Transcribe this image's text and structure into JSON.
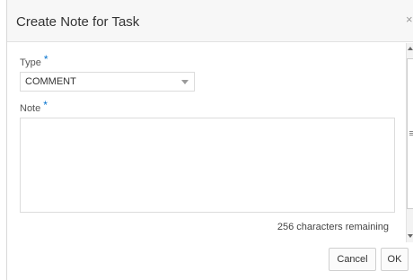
{
  "dialog": {
    "title": "Create Note for Task",
    "close_icon": "close-icon",
    "close_glyph": "×"
  },
  "form": {
    "type_label": "Type",
    "type_value": "COMMENT",
    "note_label": "Note",
    "note_value": "",
    "required_marker": "*",
    "characters_remaining": "256 characters remaining"
  },
  "footer": {
    "cancel_label": "Cancel",
    "ok_label": "OK"
  },
  "colors": {
    "required_marker": "#0572ce",
    "header_background": "#f7f7f7"
  }
}
